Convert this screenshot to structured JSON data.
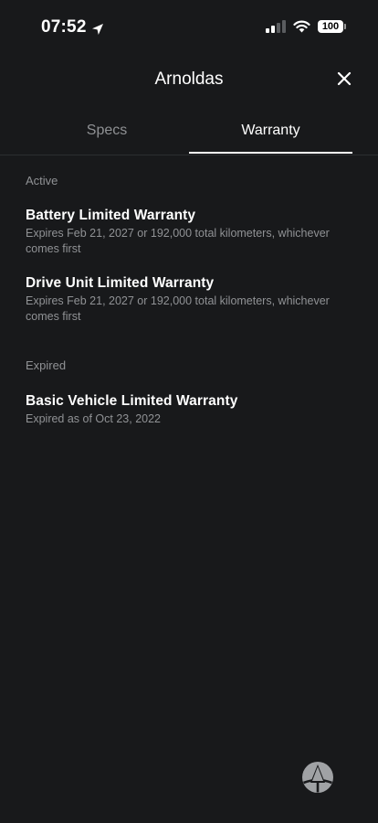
{
  "status_bar": {
    "time": "07:52",
    "battery": "100",
    "icons": [
      "location-icon",
      "signal-icon",
      "wifi-icon",
      "battery-icon"
    ]
  },
  "header": {
    "title": "Arnoldas",
    "close_icon": "close-icon"
  },
  "tabs": [
    {
      "label": "Specs",
      "active": false
    },
    {
      "label": "Warranty",
      "active": true
    }
  ],
  "sections": {
    "active": {
      "label": "Active",
      "items": [
        {
          "title": "Battery Limited Warranty",
          "detail": "Expires Feb 21, 2027 or 192,000 total kilometers, whichever comes first"
        },
        {
          "title": "Drive Unit Limited Warranty",
          "detail": "Expires Feb 21, 2027 or 192,000 total kilometers, whichever comes first"
        }
      ]
    },
    "expired": {
      "label": "Expired",
      "items": [
        {
          "title": "Basic Vehicle Limited Warranty",
          "detail": "Expired as of Oct 23, 2022"
        }
      ]
    }
  },
  "colors": {
    "background": "#18191b",
    "text_primary": "#ffffff",
    "text_secondary": "#909295",
    "divider": "#2c2e31",
    "logo": "#a0a2a5"
  },
  "floating_logo_icon": "steering-wheel-icon"
}
